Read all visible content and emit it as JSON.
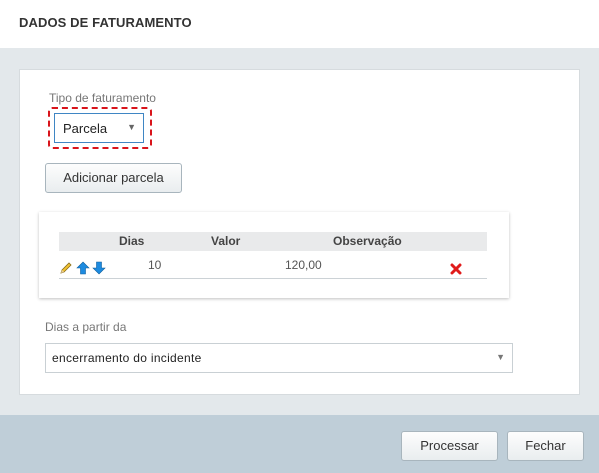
{
  "header": {
    "title": "DADOS DE FATURAMENTO"
  },
  "form": {
    "tipo_label": "Tipo de faturamento",
    "tipo_value": "Parcela",
    "add_button": "Adicionar parcela",
    "table": {
      "headers": {
        "dias": "Dias",
        "valor": "Valor",
        "observacao": "Observação"
      },
      "rows": [
        {
          "dias": "10",
          "valor": "120,00",
          "observacao": ""
        }
      ]
    },
    "dias_label": "Dias a partir da",
    "dias_value": "encerramento do incidente"
  },
  "footer": {
    "process_button": "Processar",
    "close_button": "Fechar"
  },
  "colors": {
    "highlight": "#d9141b",
    "footer_bg": "#bfced8",
    "arrow_icon": "#1d8be0",
    "delete_icon": "#e01b1b"
  }
}
